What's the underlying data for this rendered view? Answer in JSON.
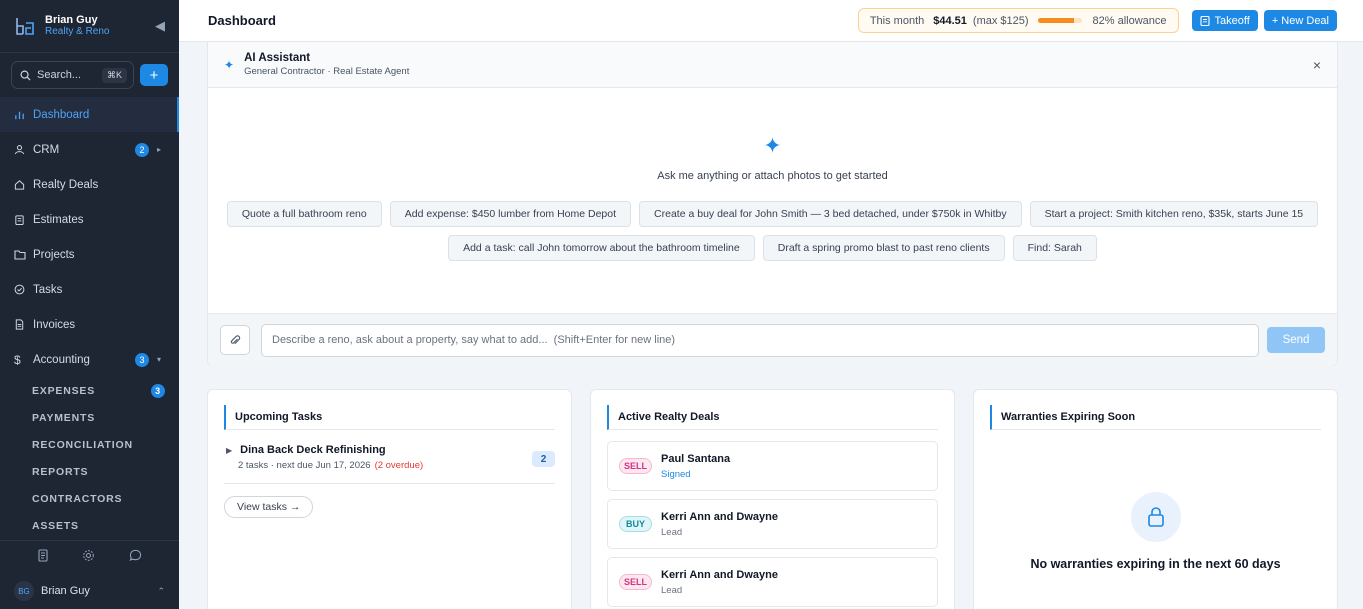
{
  "sidebar": {
    "brand_name": "Brian Guy",
    "brand_sub": "Realty & Reno",
    "search_label": "Search...",
    "search_shortcut": "⌘K",
    "nav": [
      {
        "label": "Dashboard",
        "badge": "",
        "active": true
      },
      {
        "label": "CRM",
        "badge": "2"
      },
      {
        "label": "Realty Deals",
        "badge": ""
      },
      {
        "label": "Estimates",
        "badge": ""
      },
      {
        "label": "Projects",
        "badge": ""
      },
      {
        "label": "Tasks",
        "badge": ""
      },
      {
        "label": "Invoices",
        "badge": ""
      },
      {
        "label": "Accounting",
        "badge": "3"
      }
    ],
    "accounting_sub": [
      {
        "label": "EXPENSES",
        "badge": "3"
      },
      {
        "label": "PAYMENTS"
      },
      {
        "label": "RECONCILIATION"
      },
      {
        "label": "REPORTS"
      },
      {
        "label": "CONTRACTORS"
      },
      {
        "label": "ASSETS"
      }
    ],
    "user_initials": "BG",
    "user_name": "Brian Guy"
  },
  "header": {
    "title": "Dashboard",
    "allowance_label": "This month",
    "allowance_amount": "$44.51",
    "allowance_max": "(max $125)",
    "allowance_progress": 0.82,
    "allowance_pct": "82% allowance",
    "takeoff_label": "Takeoff",
    "new_deal_label": "+ New Deal"
  },
  "ai": {
    "title": "AI Assistant",
    "subtitle": "General Contractor · Real Estate Agent",
    "prompt": "Ask me anything or attach photos to get started",
    "chips": [
      "Quote a full bathroom reno",
      "Add expense: $450 lumber from Home Depot",
      "Create a buy deal for John Smith — 3 bed detached, under $750k in Whitby",
      "Start a project: Smith kitchen reno, $35k, starts June 15",
      "Add a task: call John tomorrow about the bathroom timeline",
      "Draft a spring promo blast to past reno clients",
      "Find: Sarah"
    ],
    "input_placeholder": "Describe a reno, ask about a property, say what to add...  (Shift+Enter for new line)",
    "send_label": "Send"
  },
  "tasks_card": {
    "title": "Upcoming Tasks",
    "task_title": "Dina Back Deck Refinishing",
    "task_meta": "2 tasks · next due Jun 17, 2026",
    "task_overdue": "(2 overdue)",
    "task_count": "2",
    "view_label": "View tasks →"
  },
  "deals_card": {
    "title": "Active Realty Deals",
    "deals": [
      {
        "tag": "SELL",
        "name": "Paul Santana",
        "status": "Signed"
      },
      {
        "tag": "BUY",
        "name": "Kerri Ann and Dwayne",
        "status": "Lead"
      },
      {
        "tag": "SELL",
        "name": "Kerri Ann and Dwayne",
        "status": "Lead"
      }
    ]
  },
  "warranties_card": {
    "title": "Warranties Expiring Soon",
    "empty_text": "No warranties expiring in the next 60 days"
  }
}
